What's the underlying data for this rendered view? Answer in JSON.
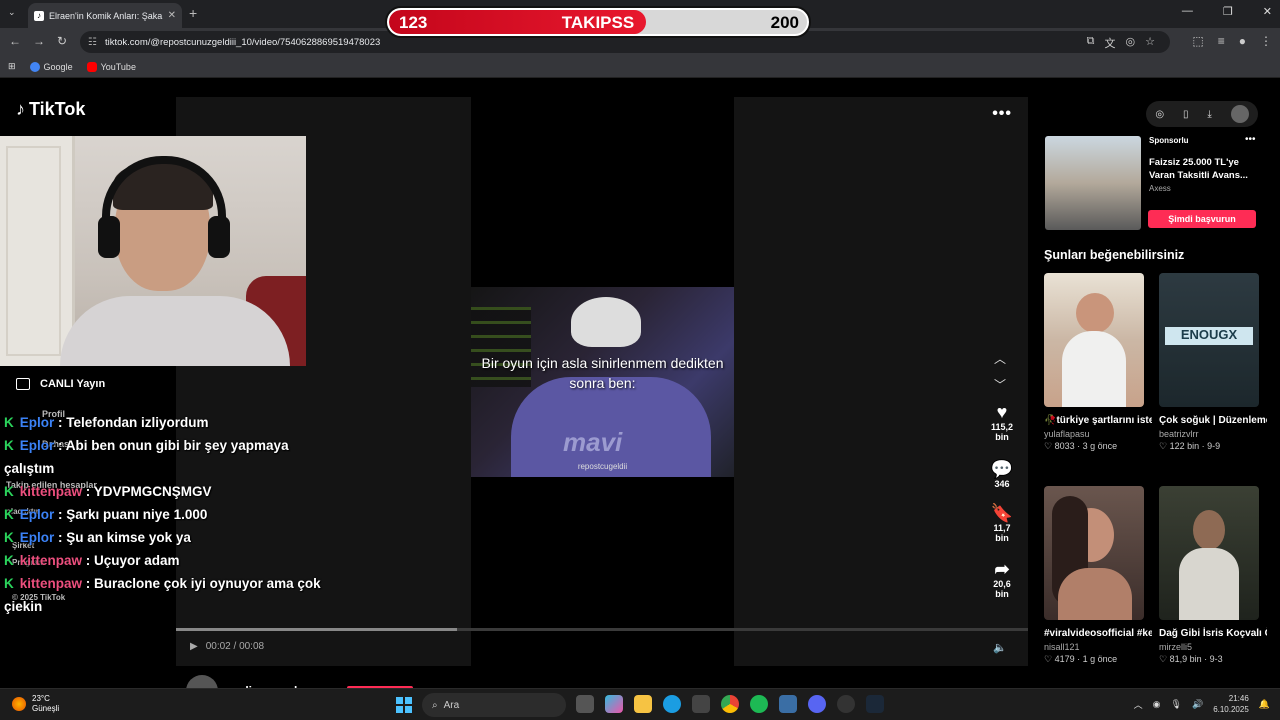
{
  "browser": {
    "tab_title": "Elraen'in Komik Anları: Şaka ve",
    "url": "tiktok.com/@repostcunuzgeldiii_10/video/7540628869519478023",
    "bookmarks": [
      {
        "label": "Google",
        "color": "#4285f4"
      },
      {
        "label": "YouTube",
        "color": "#ff0000"
      }
    ]
  },
  "banner": {
    "current": "123",
    "label": "TAKIPSS",
    "goal": "200",
    "progress": 0.615,
    "fill_color": "#e01228"
  },
  "tiktok": {
    "logo": "TikTok",
    "live_label": "CANLI Yayın",
    "sidebar_ghost": {
      "profile": "Profil",
      "more": "Dahası",
      "following": "Takip edilen hesaplar",
      "shown": "olacaktır",
      "company": "Şirket",
      "program": "Program",
      "copyright": "© 2025 TikTok"
    }
  },
  "chat": {
    "messages": [
      {
        "user": "Eplor",
        "color": "blue",
        "text": ": Telefondan izliyordum"
      },
      {
        "user": "Eplor",
        "color": "blue",
        "text": ": Abi ben onun gibi bir şey yapmaya çalıştım"
      },
      {
        "user": "kittenpaw",
        "color": "pink",
        "text": ": YDVPMGCNŞMGV"
      },
      {
        "user": "Eplor",
        "color": "blue",
        "text": ": Şarkı puanı niye 1.000"
      },
      {
        "user": "Eplor",
        "color": "blue",
        "text": ": Şu an kimse yok ya"
      },
      {
        "user": "kittenpaw",
        "color": "pink",
        "text": ": Uçuyor adam"
      },
      {
        "user": "kittenpaw",
        "color": "pink",
        "text": ": Buraclone çok iyi oynuyor ama çok çiekin"
      }
    ]
  },
  "video": {
    "caption": "Bir oyun için asla sinirlenmem dedikten sonra ben:",
    "watermark": "repostcugeldii",
    "shirt_brand": "mavi",
    "time": "00:02 / 00:08",
    "progress": 0.33,
    "likes": "115,2 bin",
    "comments": "346",
    "saves": "11,7 bin",
    "shares": "20,6 bin",
    "author": "melisaaguul"
  },
  "ad": {
    "sponsored": "Sponsorlu",
    "title": "Faizsiz 25.000 TL'ye Varan Taksitli Avans...",
    "brand": "Axess",
    "cta": "Şimdi başvurun"
  },
  "suggestions": {
    "title": "Şunları beğenebilirsiniz",
    "cards": [
      {
        "caption": "🥀türkiye şartlarını istemekmak temen...",
        "user": "yulaflapasu",
        "likes": "8033",
        "age": "3 g önce"
      },
      {
        "caption": "Çok soğuk | Düzenleme yapmak...",
        "user": "beatrizvlrr",
        "likes": "122 bin",
        "age": "9-9"
      },
      {
        "caption": "#viralvideosofficial #kesfetbeniöneçık...",
        "user": "nisall121",
        "likes": "4179",
        "age": "1 g önce"
      },
      {
        "caption": "Dağ Gibi İsris Koçvalı Öldü 😢 🥀 #çukur...",
        "user": "mirzelli5",
        "likes": "81,9 bin",
        "age": "9-3"
      }
    ]
  },
  "taskbar": {
    "temp": "23°C",
    "weather": "Güneşli",
    "search": "Ara",
    "time": "21:46",
    "date": "6.10.2025"
  }
}
